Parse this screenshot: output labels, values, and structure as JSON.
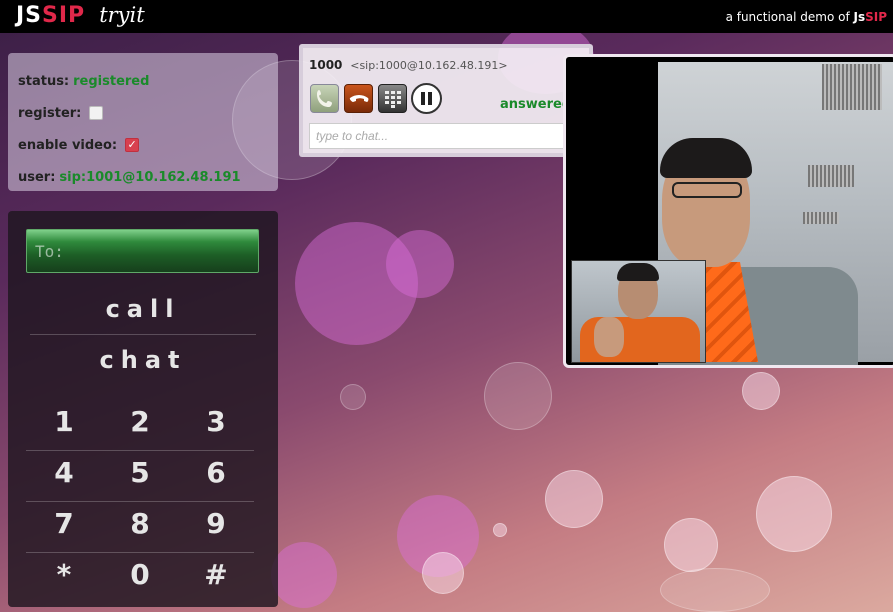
{
  "header": {
    "logo_js": "JS",
    "logo_sip": "SIP",
    "logo_tryit": "tryit",
    "tagline_prefix": "a functional demo of ",
    "tagline_brand_js": "Js",
    "tagline_brand_sip": "SIP"
  },
  "status_panel": {
    "status_label": "status:",
    "status_value": "registered",
    "register_label": "register:",
    "register_checked": false,
    "video_label": "enable video:",
    "video_checked": true,
    "user_label": "user:",
    "user_value": "sip:1001@10.162.48.191"
  },
  "dialer": {
    "to_placeholder": "To:",
    "call_label": "call",
    "chat_label": "chat",
    "keys": [
      [
        "1",
        "2",
        "3"
      ],
      [
        "4",
        "5",
        "6"
      ],
      [
        "7",
        "8",
        "9"
      ],
      [
        "*",
        "0",
        "#"
      ]
    ]
  },
  "session": {
    "number": "1000",
    "uri": "<sip:1000@10.162.48.191>",
    "state": "answered",
    "chat_placeholder": "type to chat...",
    "controls": [
      "answer-icon",
      "hangup-icon",
      "dtmf-icon",
      "hold-icon"
    ]
  },
  "colors": {
    "accent_red": "#e0284a",
    "status_green": "#1a8a2a",
    "topbar": "#000000"
  }
}
